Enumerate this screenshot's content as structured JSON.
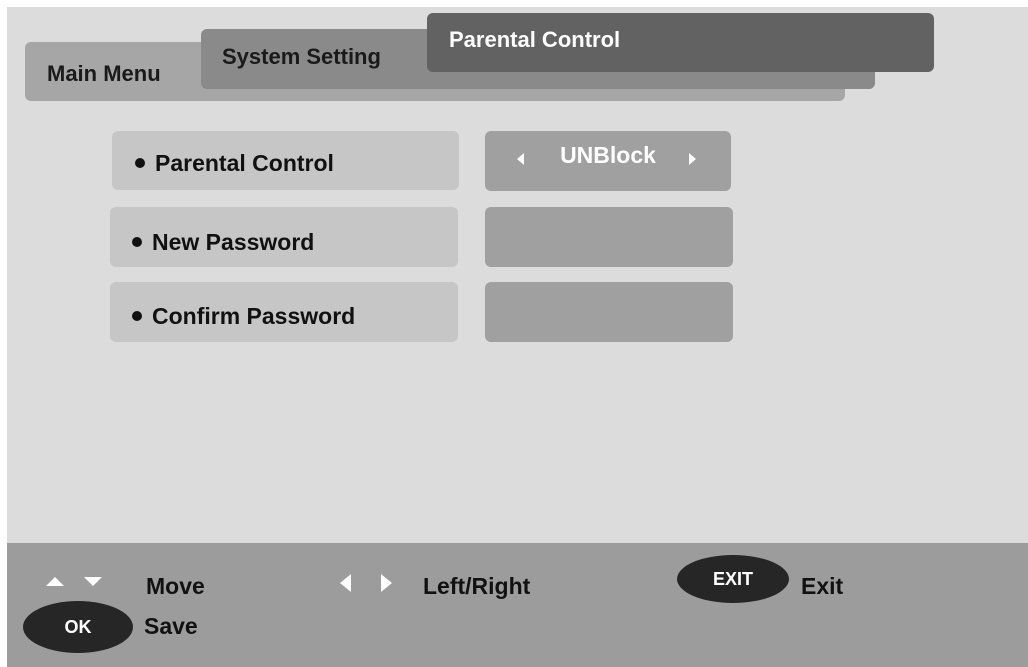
{
  "tabs": {
    "main": "Main Menu",
    "system": "System Setting",
    "active": "Parental Control"
  },
  "rows": [
    {
      "label": "Parental Control",
      "value": "UNBlock"
    },
    {
      "label": "New Password",
      "value": ""
    },
    {
      "label": "Confirm Password",
      "value": ""
    }
  ],
  "footer": {
    "move": "Move",
    "left_right": "Left/Right",
    "exit_key": "EXIT",
    "exit": "Exit",
    "ok_key": "OK",
    "save": "Save"
  },
  "icons": {
    "move": [
      "up-arrow-icon",
      "down-arrow-icon"
    ],
    "left_right": [
      "left-arrow-icon",
      "right-arrow-icon"
    ],
    "value_selector": [
      "left-arrow-icon",
      "right-arrow-icon"
    ]
  }
}
